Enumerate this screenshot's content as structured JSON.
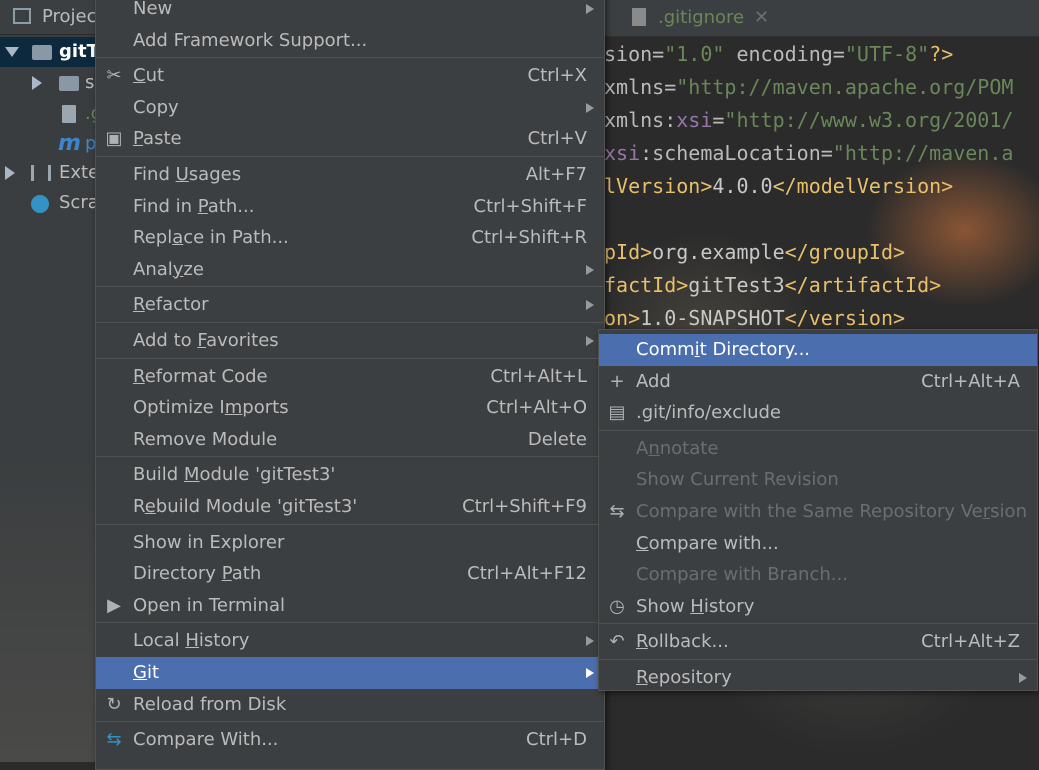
{
  "project_panel": {
    "header_title": "Projec",
    "tree": [
      {
        "label": "gitT",
        "expanded": true,
        "selected": true
      },
      {
        "label": "s",
        "expanded": false
      },
      {
        "label": ".g",
        "type": "file"
      },
      {
        "label": "p",
        "type": "maven"
      },
      {
        "label": "Exte",
        "expanded": false
      },
      {
        "label": "Scra"
      }
    ]
  },
  "editor": {
    "tab_label": ".gitignore",
    "lines": [
      {
        "parts": [
          {
            "t": "sion=",
            "c": "attr"
          },
          {
            "t": "\"1.0\"",
            "c": "str"
          },
          {
            "t": " encoding=",
            "c": "attr"
          },
          {
            "t": "\"UTF-8\"",
            "c": "str"
          },
          {
            "t": "?>",
            "c": "tag"
          }
        ]
      },
      {
        "parts": [
          {
            "t": "xmlns=",
            "c": "attr"
          },
          {
            "t": "\"http://maven.apache.org/POM",
            "c": "str"
          }
        ]
      },
      {
        "parts": [
          {
            "t": "xmlns:",
            "c": "attr"
          },
          {
            "t": "xsi",
            "c": "ns"
          },
          {
            "t": "=",
            "c": "attr"
          },
          {
            "t": "\"http://www.w3.org/2001/",
            "c": "str"
          }
        ]
      },
      {
        "parts": [
          {
            "t": "xsi",
            "c": "ns"
          },
          {
            "t": ":schemaLocation=",
            "c": "attr"
          },
          {
            "t": "\"http://maven.a",
            "c": "str"
          }
        ]
      },
      {
        "parts": [
          {
            "t": "lVersion>",
            "c": "tag"
          },
          {
            "t": "4.0.0",
            "c": "txt"
          },
          {
            "t": "</modelVersion>",
            "c": "tag"
          }
        ]
      },
      {
        "parts": []
      },
      {
        "parts": [
          {
            "t": "pId>",
            "c": "tag"
          },
          {
            "t": "org.example",
            "c": "txt"
          },
          {
            "t": "</groupId>",
            "c": "tag"
          }
        ]
      },
      {
        "parts": [
          {
            "t": "factId>",
            "c": "tag"
          },
          {
            "t": "gitTest3",
            "c": "txt"
          },
          {
            "t": "</artifactId>",
            "c": "tag"
          }
        ]
      },
      {
        "parts": [
          {
            "t": "on>",
            "c": "tag"
          },
          {
            "t": "1.0-SNAPSHOT",
            "c": "txt"
          },
          {
            "t": "</version>",
            "c": "tag"
          }
        ]
      }
    ]
  },
  "context_menu": {
    "items": [
      {
        "label": "New",
        "submenu": true
      },
      {
        "label": "Add Framework Support...",
        "sep_after": true
      },
      {
        "label": "Cut",
        "shortcut": "Ctrl+X",
        "icon": "scissors-icon",
        "u": 0
      },
      {
        "label": "Copy",
        "submenu": true
      },
      {
        "label": "Paste",
        "shortcut": "Ctrl+V",
        "icon": "clipboard-icon",
        "u": 0,
        "sep_after": true
      },
      {
        "label": "Find Usages",
        "shortcut": "Alt+F7",
        "u": 5
      },
      {
        "label": "Find in Path...",
        "shortcut": "Ctrl+Shift+F",
        "u": 8
      },
      {
        "label": "Replace in Path...",
        "shortcut": "Ctrl+Shift+R",
        "u": 4
      },
      {
        "label": "Analyze",
        "submenu": true,
        "u": 4,
        "sep_after": true
      },
      {
        "label": "Refactor",
        "submenu": true,
        "u": 0,
        "sep_after": true
      },
      {
        "label": "Add to Favorites",
        "submenu": true,
        "u": 7,
        "sep_after": true
      },
      {
        "label": "Reformat Code",
        "shortcut": "Ctrl+Alt+L",
        "u": 0
      },
      {
        "label": "Optimize Imports",
        "shortcut": "Ctrl+Alt+O",
        "u": 10
      },
      {
        "label": "Remove Module",
        "shortcut": "Delete",
        "sep_after": true
      },
      {
        "label": "Build Module 'gitTest3'",
        "u": 6
      },
      {
        "label": "Rebuild Module 'gitTest3'",
        "shortcut": "Ctrl+Shift+F9",
        "u": 1,
        "sep_after": true
      },
      {
        "label": "Show in Explorer"
      },
      {
        "label": "Directory Path",
        "shortcut": "Ctrl+Alt+F12",
        "u": 10
      },
      {
        "label": "Open in Terminal",
        "icon": "terminal-icon",
        "sep_after": true
      },
      {
        "label": "Local History",
        "submenu": true,
        "u": 6
      },
      {
        "label": "Git",
        "submenu": true,
        "active": true,
        "u": 0
      },
      {
        "label": "Reload from Disk",
        "icon": "reload-icon",
        "sep_after": true
      },
      {
        "label": "Compare With...",
        "shortcut": "Ctrl+D",
        "icon": "compare-icon"
      }
    ]
  },
  "git_submenu": {
    "items": [
      {
        "label": "Commit Directory...",
        "active": true,
        "u": 4
      },
      {
        "label": "Add",
        "shortcut": "Ctrl+Alt+A",
        "icon": "plus-icon"
      },
      {
        "label": ".git/info/exclude",
        "icon": "gitignore-file-icon",
        "sep_after": true
      },
      {
        "label": "Annotate",
        "disabled": true,
        "u": 1
      },
      {
        "label": "Show Current Revision",
        "disabled": true
      },
      {
        "label": "Compare with the Same Repository Version",
        "disabled": true,
        "icon": "compare-icon",
        "u": 35
      },
      {
        "label": "Compare with...",
        "u": 0
      },
      {
        "label": "Compare with Branch...",
        "disabled": true
      },
      {
        "label": "Show History",
        "icon": "clock-icon",
        "u": 5,
        "sep_after": true
      },
      {
        "label": "Rollback...",
        "shortcut": "Ctrl+Alt+Z",
        "icon": "rollback-icon",
        "u": 0,
        "sep_after": true
      },
      {
        "label": "Repository",
        "submenu": true,
        "u": 0
      }
    ]
  },
  "colors": {
    "menu_bg": "#3c3f41",
    "highlight": "#4b6eaf",
    "separator": "#515151",
    "disabled_text": "#6d6d6d"
  }
}
